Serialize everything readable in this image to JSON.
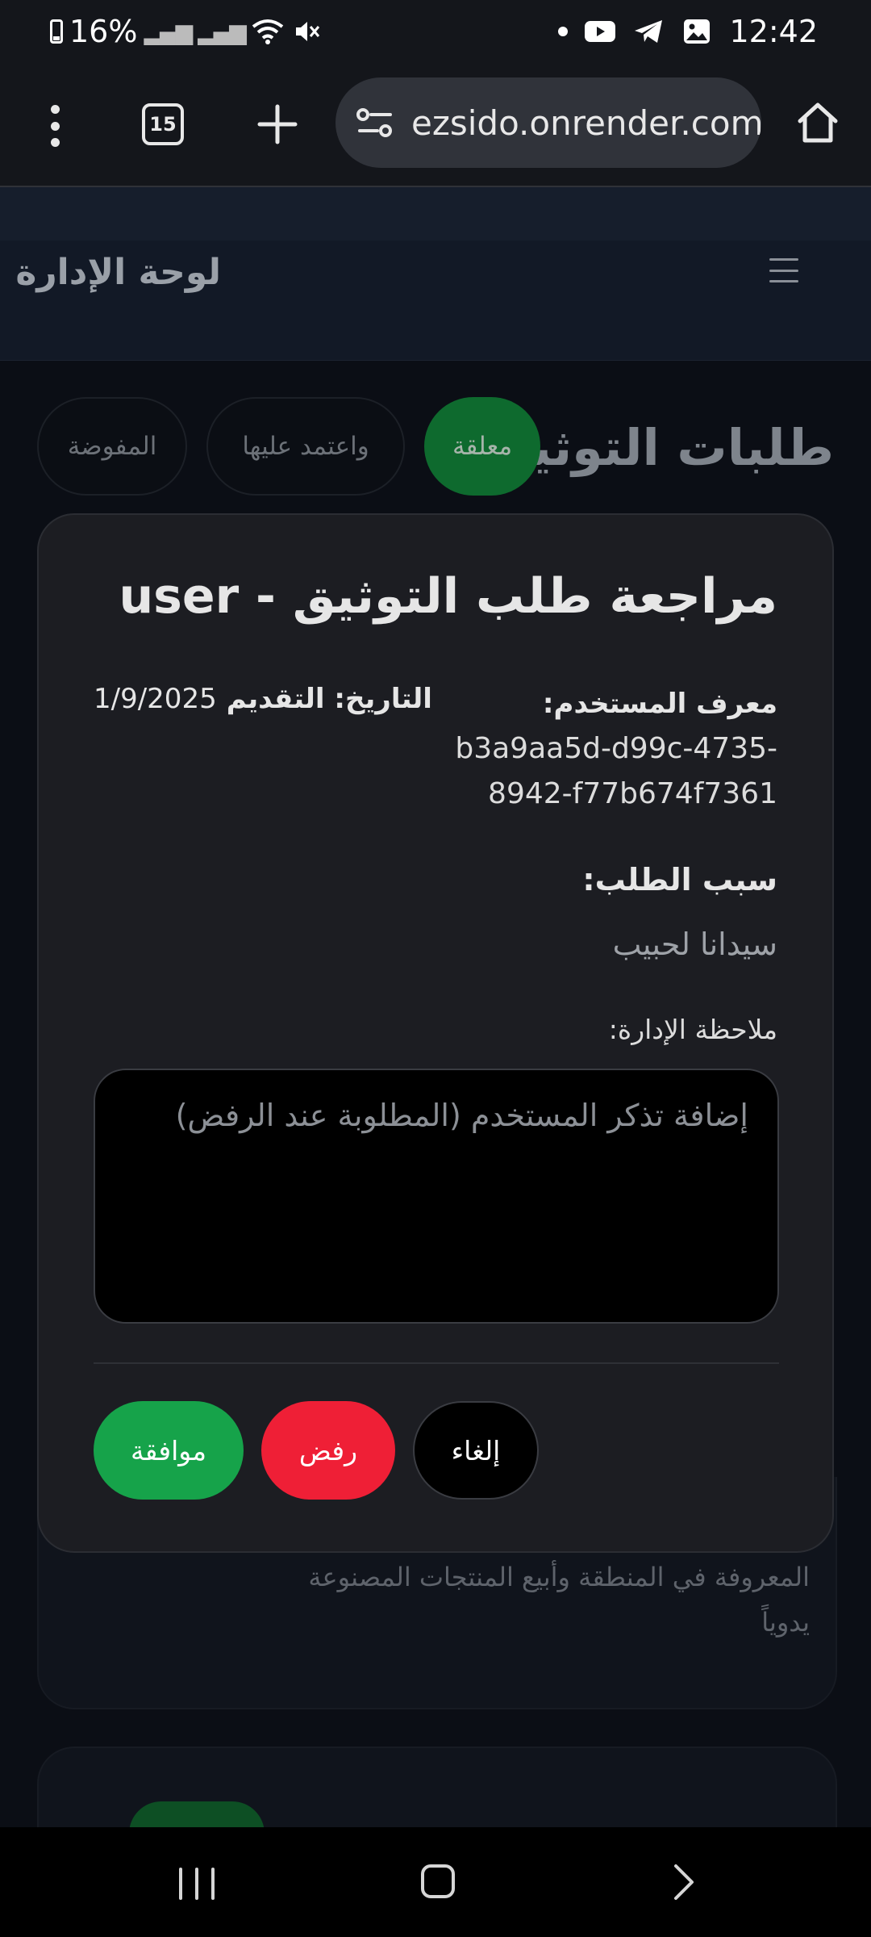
{
  "status_bar": {
    "battery": "16%",
    "time": "12:42"
  },
  "browser": {
    "tab_count": "15",
    "url": "ezsido.onrender.com"
  },
  "admin": {
    "title": "لوحة الإدارة"
  },
  "page": {
    "section_title": "طلبات التوثيق",
    "filters": {
      "pending": "معلقة",
      "approved": "واعتمد عليها",
      "rejected": "المفوضة"
    },
    "background_card_text": "المعروفة في المنطقة وأبيع المنتجات المصنوعة يدوياً"
  },
  "modal": {
    "title": "مراجعة طلب التوثيق - user",
    "user_id_label": "معرف المستخدم:",
    "user_id_value": "b3a9aa5d-d99c-4735-8942-f77b674f7361",
    "date_label": "التاريخ: التقديم",
    "date_value": "1/9/2025",
    "reason_label": "سبب الطلب:",
    "reason_value": "سيدانا لحبيب",
    "note_label": "ملاحظة الإدارة:",
    "note_placeholder": "إضافة تذكر المستخدم (المطلوبة عند الرفض)",
    "approve_label": "موافقة",
    "reject_label": "رفض",
    "cancel_label": "إلغاء"
  },
  "colors": {
    "approve": "#16a34a",
    "reject": "#ef1f36",
    "pending_filter": "#0e6a2e",
    "modal_bg": "#1c1d22",
    "page_bg": "#0b0e15"
  }
}
